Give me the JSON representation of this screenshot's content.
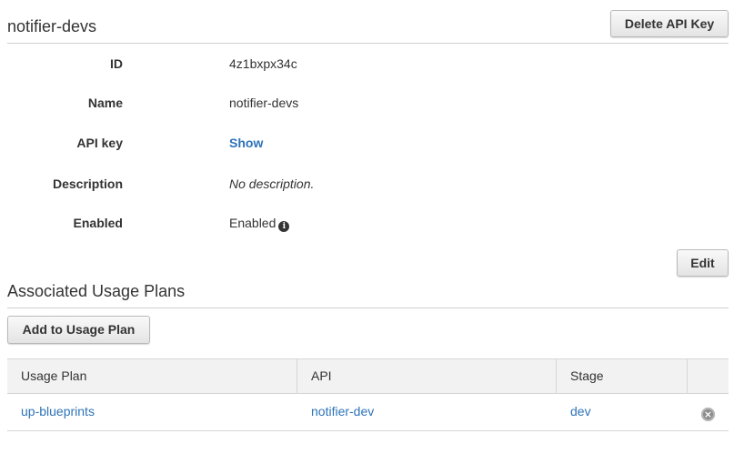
{
  "header": {
    "title": "notifier-devs",
    "delete_label": "Delete API Key"
  },
  "details": {
    "id_label": "ID",
    "id_value": "4z1bxpx34c",
    "name_label": "Name",
    "name_value": "notifier-devs",
    "api_key_label": "API key",
    "api_key_action": "Show",
    "description_label": "Description",
    "description_value": "No description.",
    "enabled_label": "Enabled",
    "enabled_value": "Enabled",
    "enabled_info_icon": "info-icon",
    "edit_label": "Edit"
  },
  "usage_plans": {
    "title": "Associated Usage Plans",
    "add_label": "Add to Usage Plan",
    "columns": [
      "Usage Plan",
      "API",
      "Stage",
      ""
    ],
    "rows": [
      {
        "usage_plan": "up-blueprints",
        "api": "notifier-dev",
        "stage": "dev",
        "remove_icon": "remove-circle-icon"
      }
    ]
  }
}
